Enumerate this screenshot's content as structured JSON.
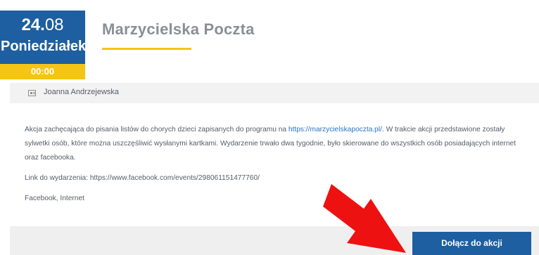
{
  "event": {
    "date_day": "24.",
    "date_month": "08",
    "weekday": "Poniedziałek",
    "time": "00:00",
    "title": "Marzycielska Poczta",
    "author": "Joanna Andrzejewska"
  },
  "description": {
    "para1_part1": "Akcja zachęcająca do pisania listów do chorych dzieci zapisanych do programu na ",
    "para1_link": "https://marzycielskapoczta.pl/",
    "para1_part2": ". W trakcie akcji przedstawione zostały sylwetki osób, które można uszczęśliwić wysłanymi kartkami. Wydarzenie trwało dwa tygodnie, było skierowane do wszystkich osób posiadających internet oraz facebooka.",
    "event_link_line": "Link do wydarzenia: https://www.facebook.com/events/298061151477760/",
    "channels": "Facebook, Internet"
  },
  "actions": {
    "join_label": "Dołącz do akcji"
  },
  "colors": {
    "brand_blue": "#1d5fa0",
    "accent_yellow": "#f4c514",
    "annotation_red": "#ee1111"
  },
  "icons": {
    "author": "id-card-icon",
    "annotation": "red-arrow-icon"
  }
}
